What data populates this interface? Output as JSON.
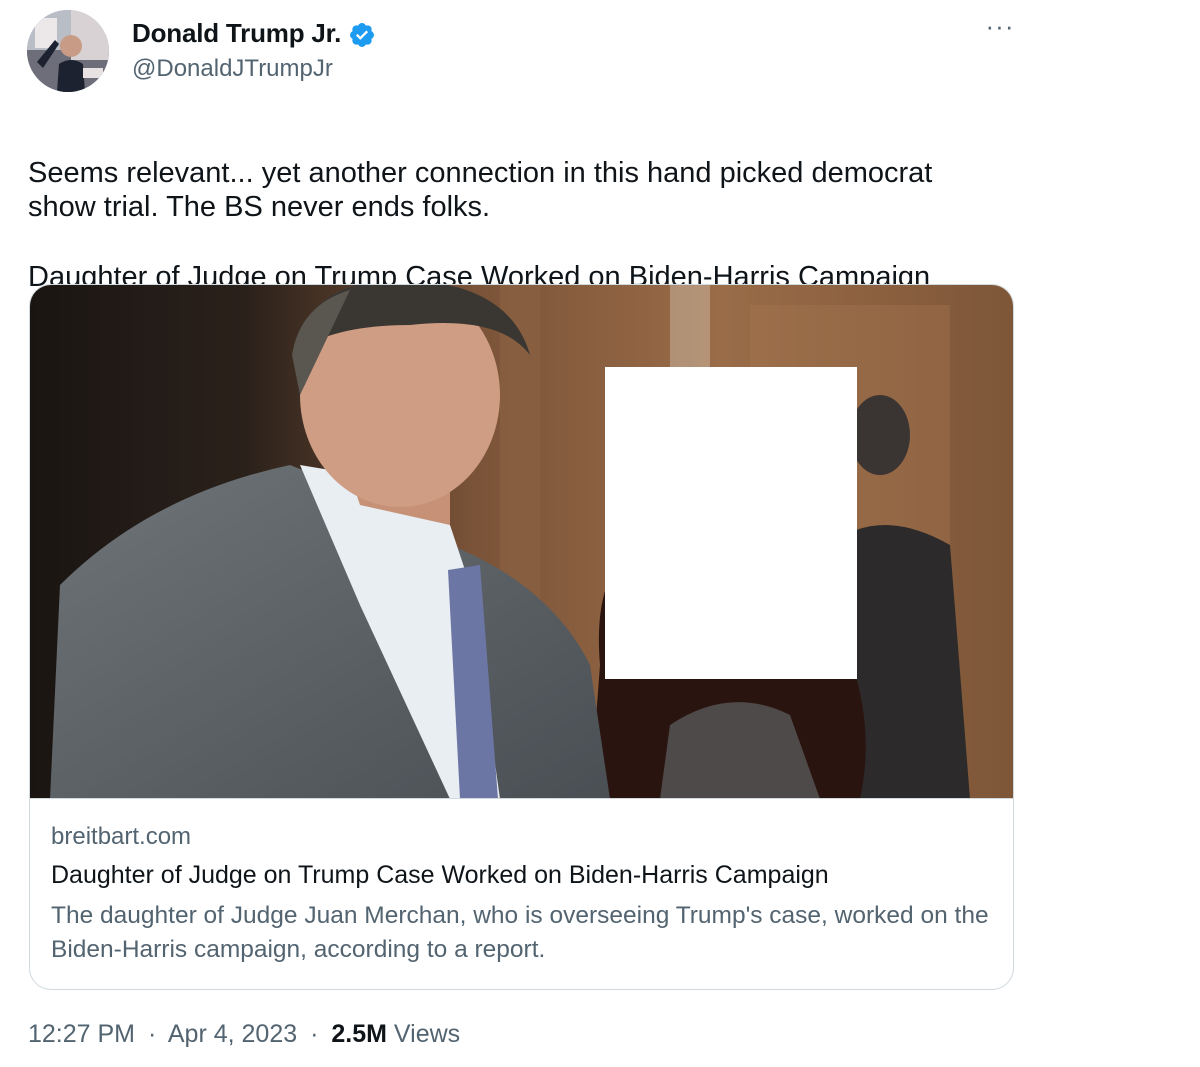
{
  "author": {
    "display_name": "Donald Trump Jr.",
    "handle": "@DonaldJTrumpJr",
    "verified_icon": "verified-badge-icon",
    "verified_color": "#1d9bf0"
  },
  "menu": {
    "more_label": "···"
  },
  "tweet": {
    "text_line1": "Seems relevant... yet another connection in this hand picked democrat\nshow trial. The BS never ends folks.",
    "text_line2": "Daughter of Judge on Trump Case Worked on Biden-Harris Campaign"
  },
  "card": {
    "domain": "breitbart.com",
    "title": "Daughter of Judge on Trump Case Worked on Biden-Harris Campaign",
    "description": "The daughter of Judge Juan Merchan, who is overseeing Trump's case, worked on the Biden-Harris campaign, according to a report."
  },
  "footer": {
    "time": "12:27 PM",
    "date": "Apr 4, 2023",
    "separator": "·",
    "views_count": "2.5M",
    "views_label": "Views"
  },
  "colors": {
    "text_primary": "#0f1419",
    "text_secondary": "#536471",
    "border": "#cfd9de"
  }
}
